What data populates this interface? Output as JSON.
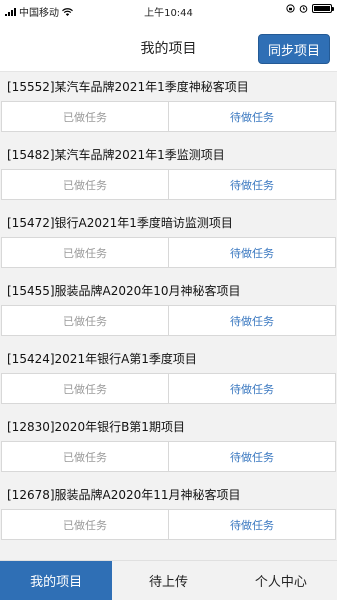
{
  "status_bar": {
    "carrier": "中国移动",
    "time": "上午10:44"
  },
  "header": {
    "title": "我的项目",
    "sync_label": "同步项目"
  },
  "projects": [
    {
      "title": "[15552]某汽车品牌2021年1季度神秘客项目",
      "done_label": "已做任务",
      "todo_label": "待做任务"
    },
    {
      "title": "[15482]某汽车品牌2021年1季监测项目",
      "done_label": "已做任务",
      "todo_label": "待做任务"
    },
    {
      "title": "[15472]银行A2021年1季度暗访监测项目",
      "done_label": "已做任务",
      "todo_label": "待做任务"
    },
    {
      "title": "[15455]服装品牌A2020年10月神秘客项目",
      "done_label": "已做任务",
      "todo_label": "待做任务"
    },
    {
      "title": "[15424]2021年银行A第1季度项目",
      "done_label": "已做任务",
      "todo_label": "待做任务"
    },
    {
      "title": "[12830]2020年银行B第1期项目",
      "done_label": "已做任务",
      "todo_label": "待做任务"
    },
    {
      "title": "[12678]服装品牌A2020年11月神秘客项目",
      "done_label": "已做任务",
      "todo_label": "待做任务"
    }
  ],
  "tabs": [
    {
      "label": "我的项目",
      "active": true
    },
    {
      "label": "待上传",
      "active": false
    },
    {
      "label": "个人中心",
      "active": false
    }
  ],
  "colors": {
    "accent": "#2f6fb5",
    "todo_text": "#3a78c0",
    "done_text": "#9a9a9a"
  }
}
